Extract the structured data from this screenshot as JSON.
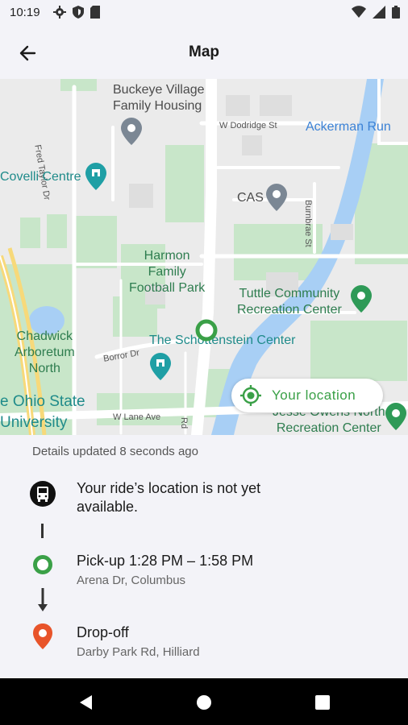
{
  "status_bar": {
    "time": "10:19"
  },
  "app_bar": {
    "title": "Map"
  },
  "map": {
    "labels": {
      "buckeye_village": "Buckeye Village\nFamily Housing",
      "ackerman_run": "Ackerman Run",
      "w_dodridge": "W Dodridge St",
      "fred_taylor": "Fred Taylor Dr",
      "covelli": "Covelli Centre",
      "cas": "CAS",
      "burnbrae": "Burnbrae St",
      "harmon": "Harmon\nFamily\nFootball Park",
      "tuttle": "Tuttle Community\nRecreation Center",
      "chadwick": "Chadwick\nArboretum\nNorth",
      "schottenstein": "The Schottenstein Center",
      "borror": "Borror Dr",
      "ohio_state": "e Ohio State\nUniversity",
      "w_lane": "W Lane Ave",
      "rd": "Rd",
      "jesse_owens": "Jesse Owens North\nRecreation Center"
    }
  },
  "location_button": {
    "label": "Your location"
  },
  "details": {
    "updated": "Details updated 8 seconds ago",
    "ride_status": "Your ride’s location is not yet\navailable.",
    "pickup": {
      "title": "Pick-up 1:28 PM – 1:58 PM",
      "address": "Arena Dr, Columbus"
    },
    "dropoff": {
      "title": "Drop-off",
      "address": "Darby Park Rd, Hilliard"
    }
  },
  "colors": {
    "accent_green": "#3aa047",
    "dropoff_orange": "#e8542a",
    "map_park": "#c8e6c9",
    "map_water": "#a8cff5"
  }
}
